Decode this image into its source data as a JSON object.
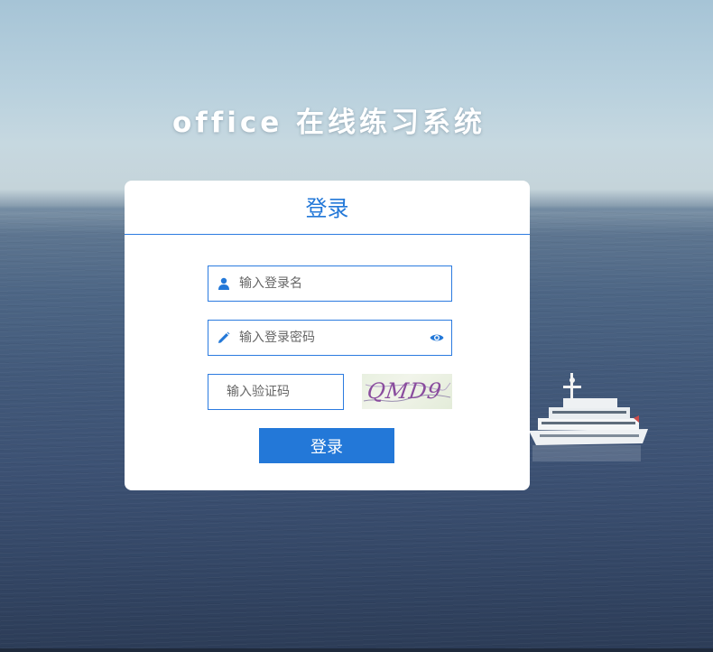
{
  "app": {
    "title": "office 在线练习系统"
  },
  "login": {
    "heading": "登录",
    "username_placeholder": "输入登录名",
    "password_placeholder": "输入登录密码",
    "captcha_placeholder": "输入验证码",
    "captcha_text": "QMD9",
    "submit_label": "登录"
  },
  "icons": {
    "username": "user-icon",
    "password": "pencil-icon",
    "password_toggle": "eye-icon"
  },
  "colors": {
    "accent": "#2378d8",
    "field_border": "#2c7be0",
    "card_bg": "#ffffff",
    "captcha_text": "#8a4d9e"
  }
}
